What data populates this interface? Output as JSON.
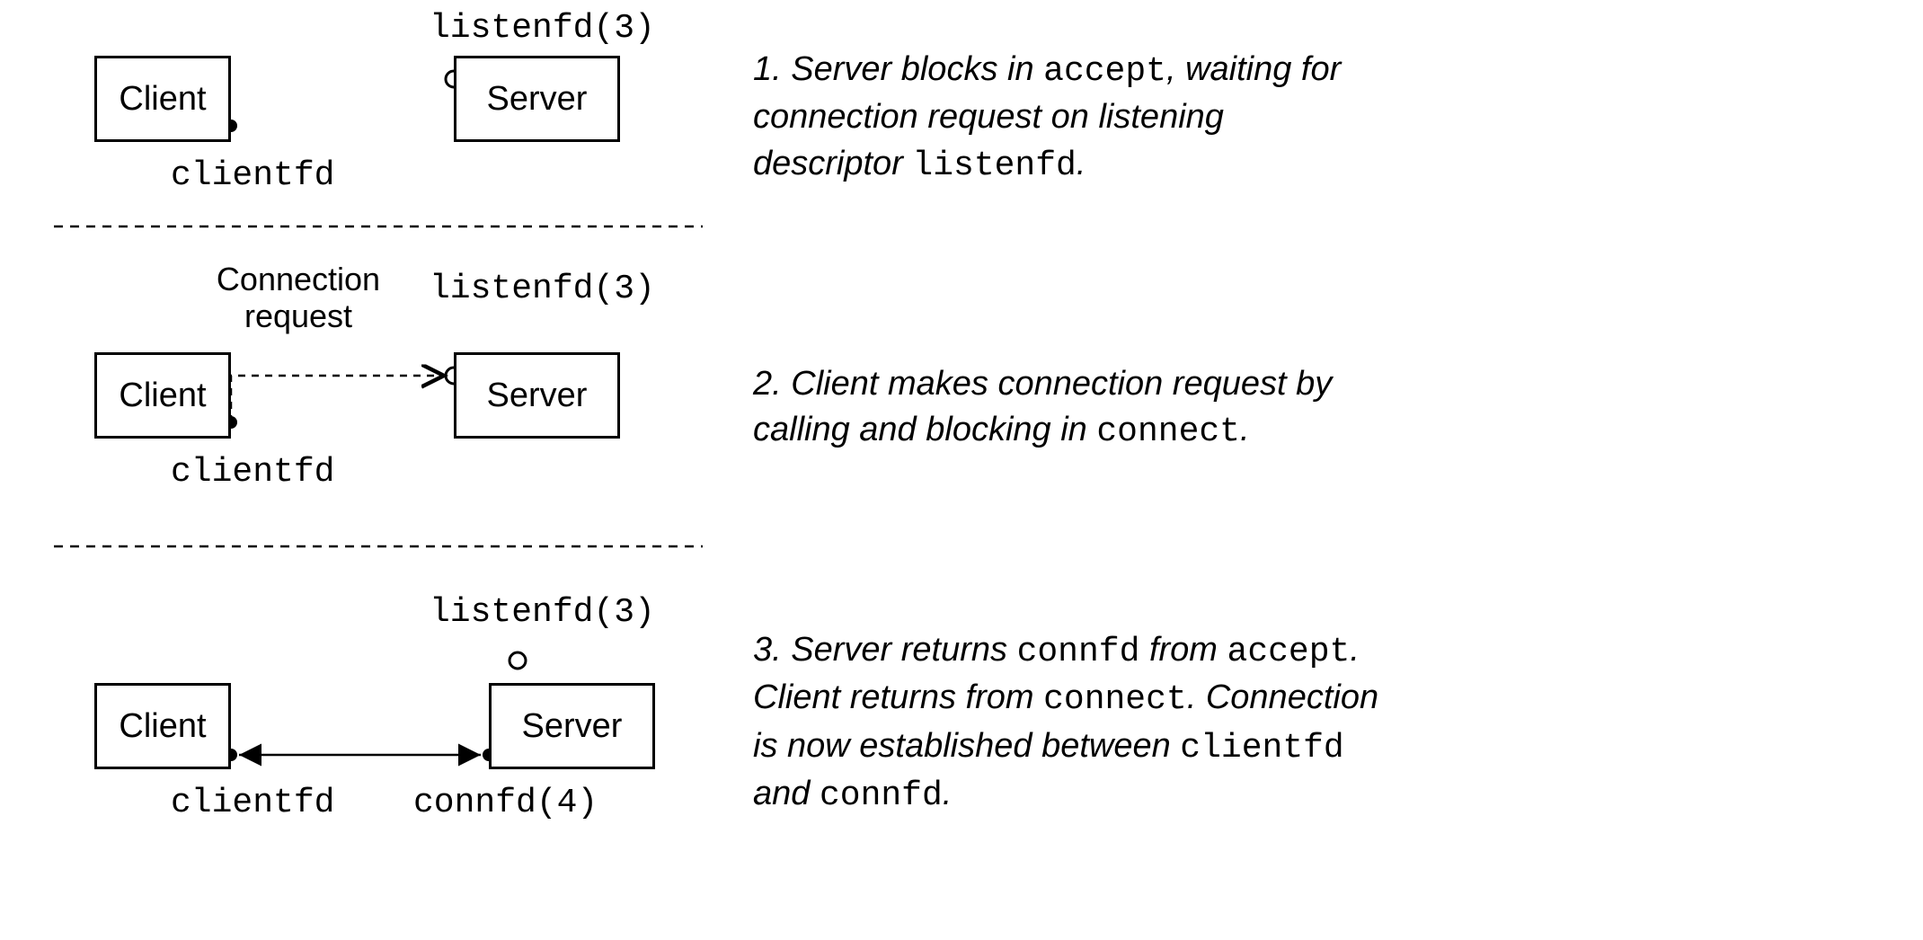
{
  "steps": [
    {
      "client_label": "Client",
      "server_label": "Server",
      "clientfd": "clientfd",
      "listenfd": "listenfd(3)",
      "caption_parts": {
        "p1": "1. Server blocks in ",
        "c1": "accept",
        "p2": ", waiting for connection request on listening descriptor ",
        "c2": "listenfd",
        "p3": "."
      }
    },
    {
      "client_label": "Client",
      "server_label": "Server",
      "clientfd": "clientfd",
      "listenfd": "listenfd(3)",
      "conn_req_l1": "Connection",
      "conn_req_l2": "request",
      "caption_parts": {
        "p1": "2. Client makes connection request by calling and blocking in ",
        "c1": "connect",
        "p2": "."
      }
    },
    {
      "client_label": "Client",
      "server_label": "Server",
      "clientfd": "clientfd",
      "listenfd": "listenfd(3)",
      "connfd": "connfd(4)",
      "caption_parts": {
        "p1": "3. Server returns ",
        "c1": "connfd",
        "p2": " from ",
        "c2": "accept",
        "p3": ". Client returns from ",
        "c3": "connect",
        "p4": ". Connection is now established between ",
        "c4": "clientfd",
        "p5": " and ",
        "c5": "connfd",
        "p6": "."
      }
    }
  ]
}
